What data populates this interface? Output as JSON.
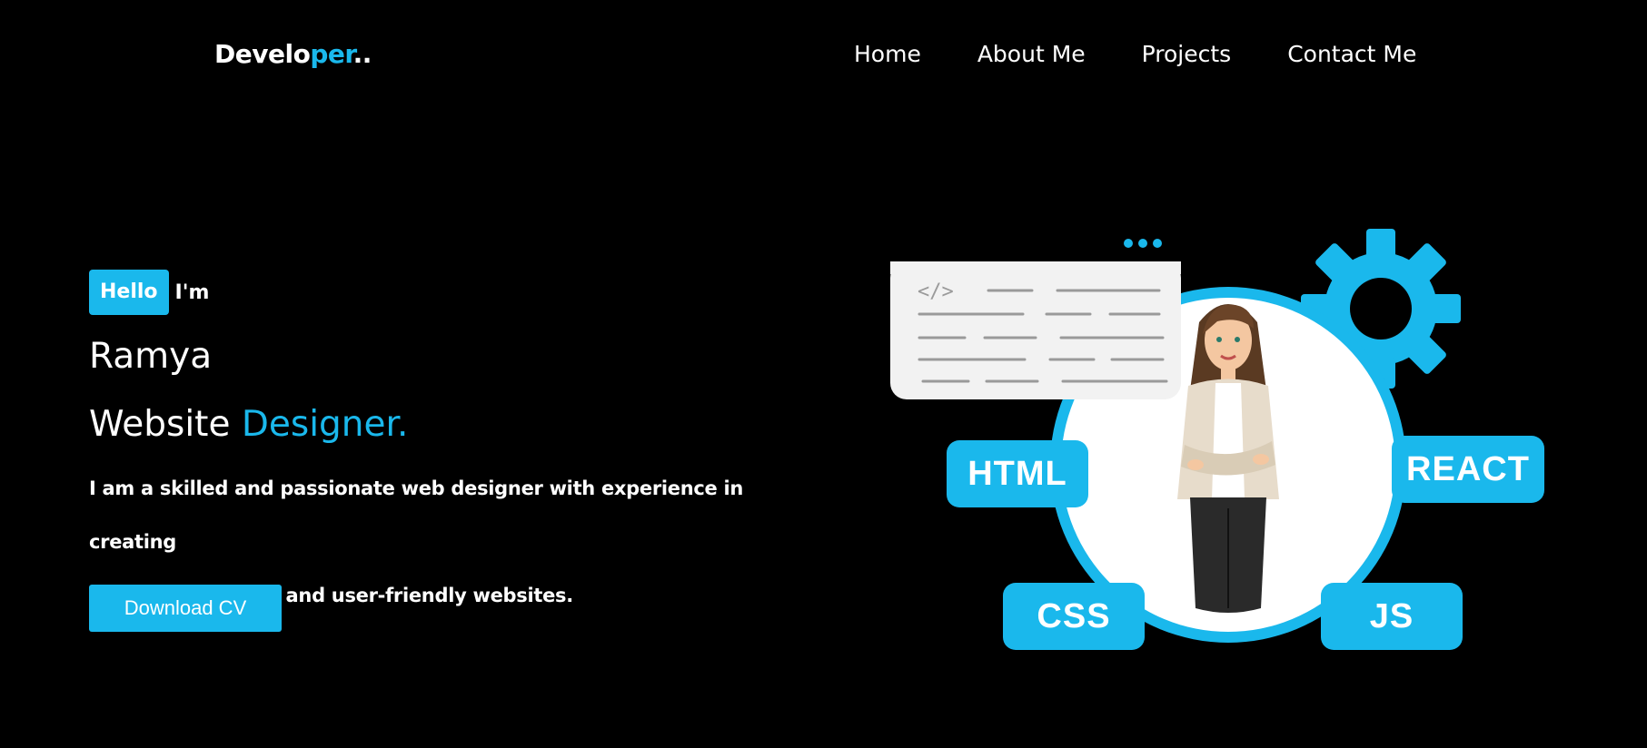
{
  "header": {
    "logo_main": "Develo",
    "logo_accent": "per",
    "logo_suffix": "..",
    "nav": [
      "Home",
      "About Me",
      "Projects",
      "Contact Me"
    ]
  },
  "hero": {
    "hello_badge": "Hello",
    "im": "I'm",
    "name": "Ramya",
    "role_prefix": "Website ",
    "role_accent": "Designer.",
    "description_line1": "I am a skilled and passionate web designer with experience in creating",
    "description_line2": "visually appealing and user-friendly websites.",
    "cv_button": "Download CV"
  },
  "illustration": {
    "code_tag": "</>",
    "tags": [
      "HTML",
      "REACT",
      "CSS",
      "JS"
    ]
  },
  "colors": {
    "background": "#000000",
    "accent": "#1ab8ec",
    "text": "#ffffff"
  }
}
